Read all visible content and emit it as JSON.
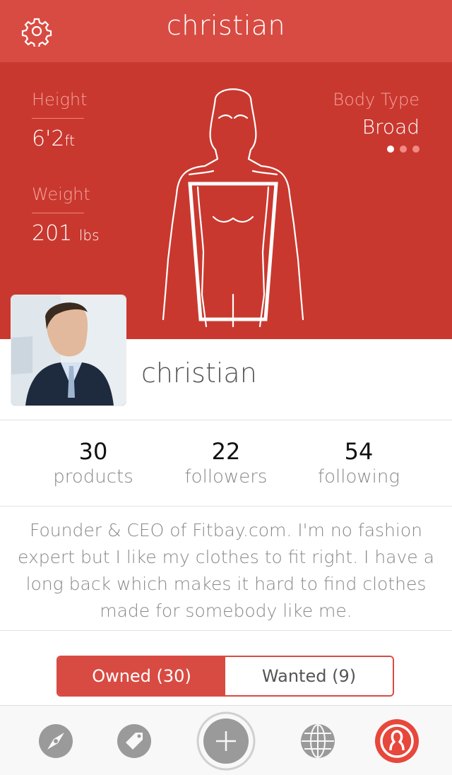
{
  "header": {
    "title": "christian",
    "settings_icon": "gear-icon"
  },
  "body_stats": {
    "height_label": "Height",
    "height_value": "6'2",
    "height_unit": "ft",
    "weight_label": "Weight",
    "weight_value": "201",
    "weight_unit": "lbs",
    "body_type_label": "Body Type",
    "body_type_value": "Broad",
    "pager": {
      "count": 3,
      "active": 0
    }
  },
  "profile": {
    "name": "christian",
    "stats": [
      {
        "value": "30",
        "label": "products"
      },
      {
        "value": "22",
        "label": "followers"
      },
      {
        "value": "54",
        "label": "following"
      }
    ],
    "bio": "Founder & CEO of Fitbay.com. I'm no fashion expert but I like my clothes to fit right. I have a long back which makes it hard to find clothes made for somebody like me."
  },
  "segments": {
    "owned": "Owned (30)",
    "wanted": "Wanted (9)",
    "active": "owned"
  },
  "tabbar": {
    "items": [
      "compass-icon",
      "tag-icon",
      "plus-icon",
      "globe-icon",
      "profile-icon"
    ],
    "active": "profile-icon"
  },
  "colors": {
    "accent": "#d84b42",
    "hero": "#c9382f",
    "muted_text": "#888888"
  }
}
